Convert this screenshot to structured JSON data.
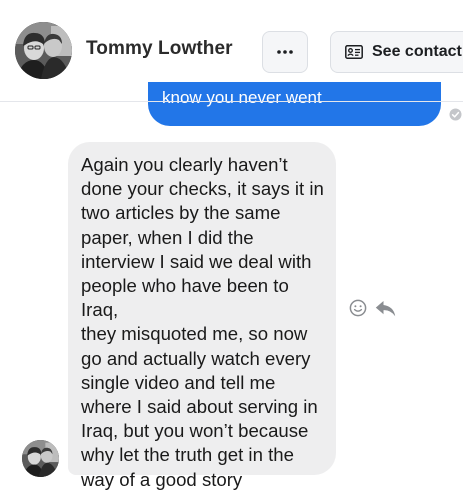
{
  "header": {
    "contact_name": "Tommy Lowther",
    "more_icon": "more-horizontal-icon",
    "see_contact_label": "See contact",
    "see_contact_icon": "contact-card-icon"
  },
  "conversation": {
    "outgoing_message": {
      "text": "know you never went",
      "bubble_color": "#2276e8",
      "status_icon": "read-indicator-icon"
    },
    "incoming_message": {
      "text": "Again you clearly haven’t\ndone your checks, it says it in\ntwo articles by the same\npaper, when I did the\ninterview I said we deal with\npeople who have been to Iraq,\nthey misquoted me, so now\ngo and actually watch every\nsingle video and tell me\nwhere I said about serving in\nIraq, but you won’t because\nwhy let the truth get in the\nway of a good story",
      "bubble_color": "#eeeeef",
      "actions": [
        "react-icon",
        "reply-icon"
      ]
    }
  },
  "colors": {
    "accent": "#2276e8",
    "icon_gray": "#8a8d91"
  }
}
